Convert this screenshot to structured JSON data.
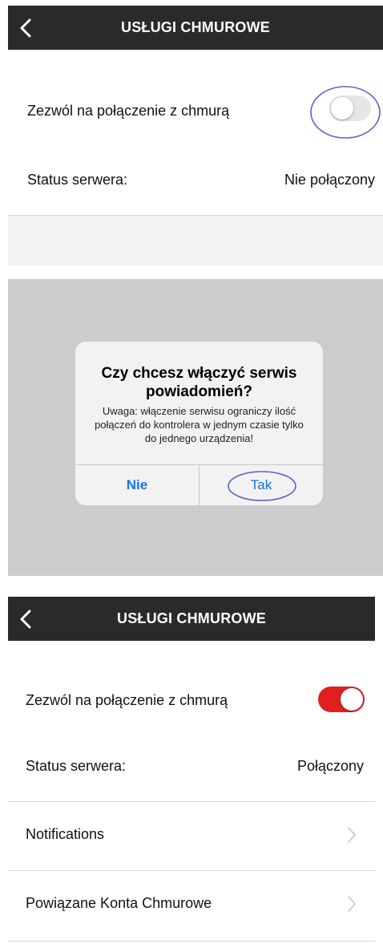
{
  "screen1": {
    "header": {
      "title": "USŁUGI CHMUROWE"
    },
    "allow_cloud_label": "Zezwól na połączenie z chmurą",
    "server_status_label": "Status serwera:",
    "server_status_value": "Nie połączony"
  },
  "dialog": {
    "title": "Czy chcesz włączyć serwis powiadomień?",
    "message": "Uwaga: włączenie serwisu ograniczy ilość połączeń do kontrolera w jednym czasie tylko do jednego urządzenia!",
    "no_label": "Nie",
    "yes_label": "Tak"
  },
  "screen2": {
    "header": {
      "title": "USŁUGI CHMUROWE"
    },
    "allow_cloud_label": "Zezwól na połączenie z chmurą",
    "server_status_label": "Status serwera:",
    "server_status_value": "Połączony",
    "notifications_label": "Notifications",
    "linked_accounts_label": "Powiązane Konta Chmurowe"
  },
  "colors": {
    "navbar": "#2a2a2a",
    "toggle_on": "#e02020",
    "toggle_off": "#e6e6e6",
    "ios_blue": "#1a73e8",
    "highlight_circle": "#5a63c8",
    "overlay": "#cccccc"
  }
}
